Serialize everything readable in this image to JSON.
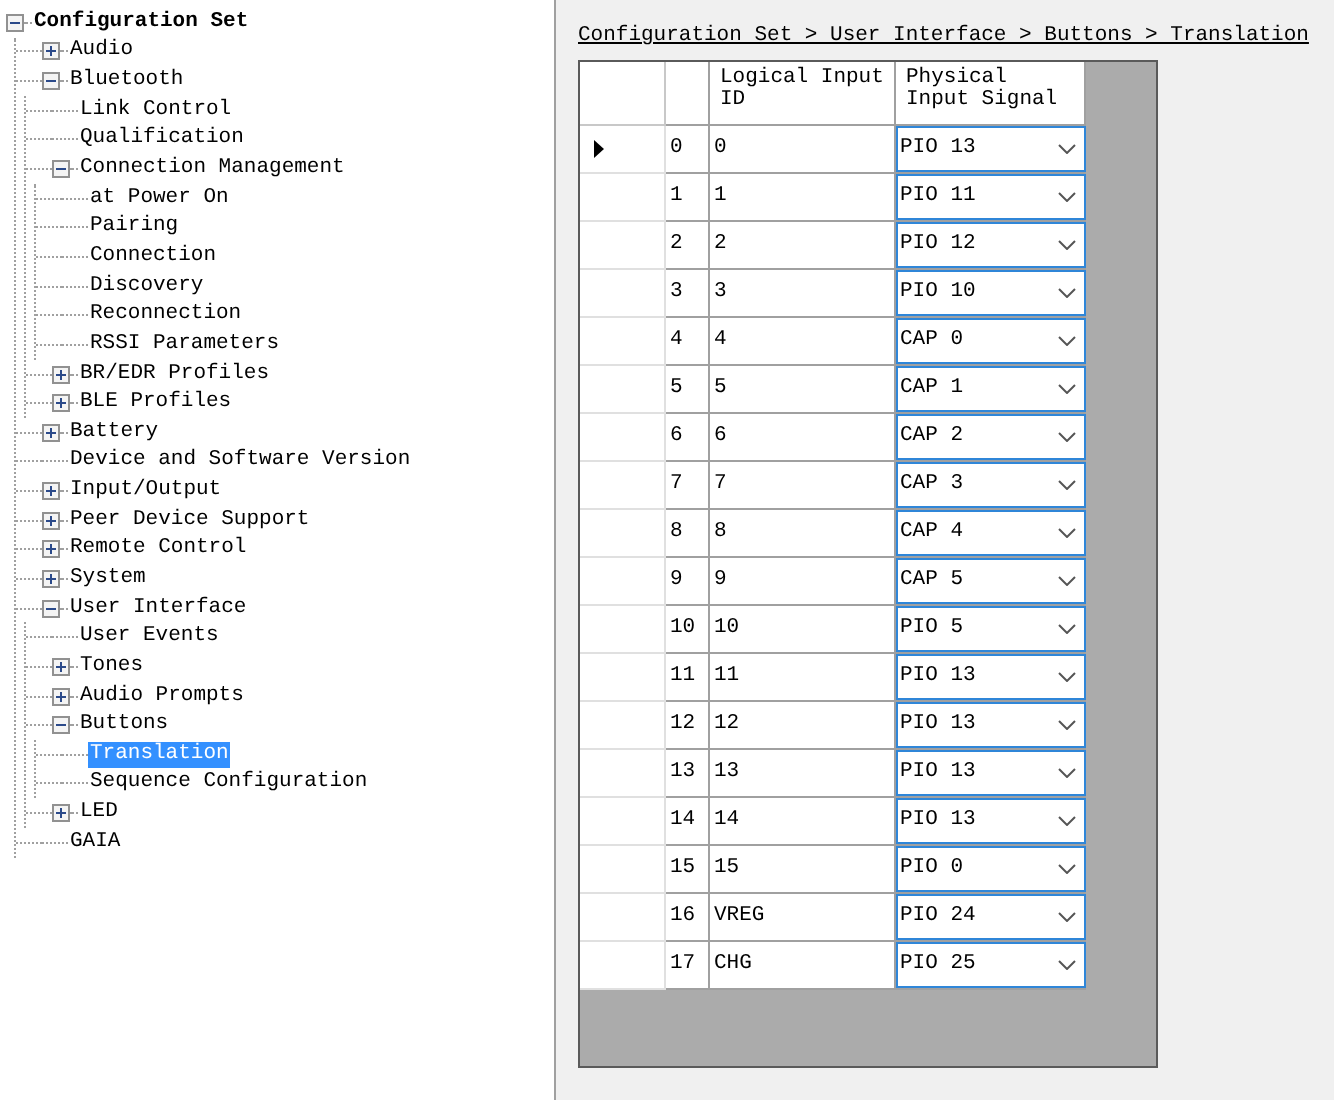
{
  "tree": [
    {
      "label": "Configuration Set",
      "expanded": true,
      "selected": false,
      "children": [
        {
          "label": "Audio",
          "expanded": false,
          "selected": false
        },
        {
          "label": "Bluetooth",
          "expanded": true,
          "selected": false,
          "children": [
            {
              "label": "Link Control",
              "selected": false
            },
            {
              "label": "Qualification",
              "selected": false
            },
            {
              "label": "Connection Management",
              "expanded": true,
              "selected": false,
              "children": [
                {
                  "label": "at Power On",
                  "selected": false
                },
                {
                  "label": "Pairing",
                  "selected": false
                },
                {
                  "label": "Connection",
                  "selected": false
                },
                {
                  "label": "Discovery",
                  "selected": false
                },
                {
                  "label": "Reconnection",
                  "selected": false
                },
                {
                  "label": "RSSI Parameters",
                  "selected": false
                }
              ]
            },
            {
              "label": "BR/EDR Profiles",
              "expanded": false,
              "selected": false
            },
            {
              "label": "BLE Profiles",
              "expanded": false,
              "selected": false
            }
          ]
        },
        {
          "label": "Battery",
          "expanded": false,
          "selected": false
        },
        {
          "label": "Device and Software Version",
          "selected": false
        },
        {
          "label": "Input/Output",
          "expanded": false,
          "selected": false
        },
        {
          "label": "Peer Device Support",
          "expanded": false,
          "selected": false
        },
        {
          "label": "Remote Control",
          "expanded": false,
          "selected": false
        },
        {
          "label": "System",
          "expanded": false,
          "selected": false
        },
        {
          "label": "User Interface",
          "expanded": true,
          "selected": false,
          "children": [
            {
              "label": "User Events",
              "selected": false
            },
            {
              "label": "Tones",
              "expanded": false,
              "selected": false
            },
            {
              "label": "Audio Prompts",
              "expanded": false,
              "selected": false
            },
            {
              "label": "Buttons",
              "expanded": true,
              "selected": false,
              "children": [
                {
                  "label": "Translation",
                  "selected": true
                },
                {
                  "label": "Sequence Configuration",
                  "selected": false
                }
              ]
            },
            {
              "label": "LED",
              "expanded": false,
              "selected": false
            }
          ]
        },
        {
          "label": "GAIA",
          "selected": false
        }
      ]
    }
  ],
  "breadcrumb": "Configuration Set > User Interface > Buttons > Translation",
  "table": {
    "columns": [
      "Logical Input ID",
      "Physical Input Signal"
    ],
    "rows": [
      {
        "index": "0",
        "logical_input_id": "0",
        "physical_input_signal": "PIO 13",
        "selected": true
      },
      {
        "index": "1",
        "logical_input_id": "1",
        "physical_input_signal": "PIO 11",
        "selected": false
      },
      {
        "index": "2",
        "logical_input_id": "2",
        "physical_input_signal": "PIO 12",
        "selected": false
      },
      {
        "index": "3",
        "logical_input_id": "3",
        "physical_input_signal": "PIO 10",
        "selected": false
      },
      {
        "index": "4",
        "logical_input_id": "4",
        "physical_input_signal": "CAP 0",
        "selected": false
      },
      {
        "index": "5",
        "logical_input_id": "5",
        "physical_input_signal": "CAP 1",
        "selected": false
      },
      {
        "index": "6",
        "logical_input_id": "6",
        "physical_input_signal": "CAP 2",
        "selected": false
      },
      {
        "index": "7",
        "logical_input_id": "7",
        "physical_input_signal": "CAP 3",
        "selected": false
      },
      {
        "index": "8",
        "logical_input_id": "8",
        "physical_input_signal": "CAP 4",
        "selected": false
      },
      {
        "index": "9",
        "logical_input_id": "9",
        "physical_input_signal": "CAP 5",
        "selected": false
      },
      {
        "index": "10",
        "logical_input_id": "10",
        "physical_input_signal": "PIO 5",
        "selected": false
      },
      {
        "index": "11",
        "logical_input_id": "11",
        "physical_input_signal": "PIO 13",
        "selected": false
      },
      {
        "index": "12",
        "logical_input_id": "12",
        "physical_input_signal": "PIO 13",
        "selected": false
      },
      {
        "index": "13",
        "logical_input_id": "13",
        "physical_input_signal": "PIO 13",
        "selected": false
      },
      {
        "index": "14",
        "logical_input_id": "14",
        "physical_input_signal": "PIO 13",
        "selected": false
      },
      {
        "index": "15",
        "logical_input_id": "15",
        "physical_input_signal": "PIO 0",
        "selected": false
      },
      {
        "index": "16",
        "logical_input_id": "VREG",
        "physical_input_signal": "PIO 24",
        "selected": false
      },
      {
        "index": "17",
        "logical_input_id": "CHG",
        "physical_input_signal": "PIO 25",
        "selected": false
      }
    ]
  }
}
